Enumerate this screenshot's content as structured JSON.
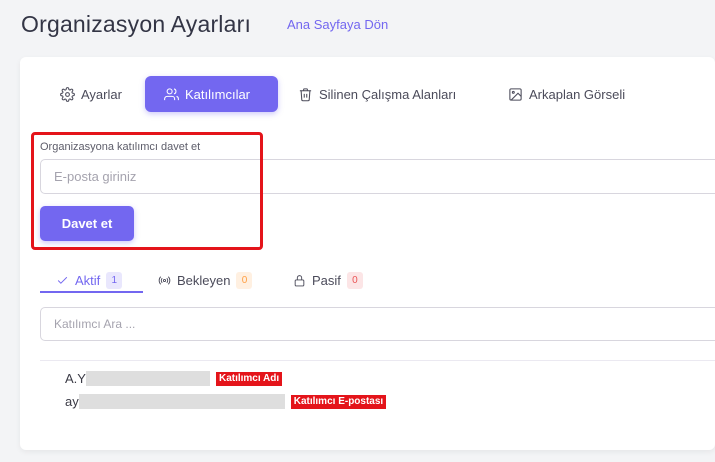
{
  "header": {
    "title": "Organizasyon Ayarları",
    "back_link": "Ana Sayfaya Dön"
  },
  "tabs": [
    {
      "label": "Ayarlar",
      "icon": "gear-icon",
      "active": false
    },
    {
      "label": "Katılımcılar",
      "icon": "users-icon",
      "active": true
    },
    {
      "label": "Silinen Çalışma Alanları",
      "icon": "trash-icon",
      "active": false
    },
    {
      "label": "Arkaplan Görseli",
      "icon": "image-icon",
      "active": false
    }
  ],
  "invite": {
    "label": "Organizasyona katılımcı davet et",
    "placeholder": "E-posta giriniz",
    "button": "Davet et"
  },
  "subtabs": [
    {
      "label": "Aktif",
      "count": "1",
      "icon": "check-icon",
      "active": true
    },
    {
      "label": "Bekleyen",
      "count": "0",
      "icon": "broadcast-icon",
      "active": false
    },
    {
      "label": "Pasif",
      "count": "0",
      "icon": "lock-icon",
      "active": false
    }
  ],
  "search": {
    "placeholder": "Katılımcı Ara ..."
  },
  "participant": {
    "name_prefix": "A.Y",
    "email_prefix": "ay",
    "name_annotation": "Katılımcı Adı",
    "email_annotation": "Katılımcı E-postası"
  },
  "colors": {
    "accent": "#7367f0",
    "annotation_red": "#e4141a",
    "background": "#f3f4f6"
  }
}
